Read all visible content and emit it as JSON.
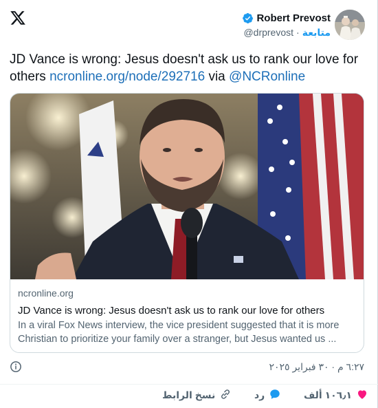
{
  "header": {
    "logo": "x-logo-icon",
    "author_name": "Robert Prevost",
    "handle": "@drprevost",
    "separator": "·",
    "follow_label": "متابعة",
    "verified_color": "#1d9bf0"
  },
  "tweet": {
    "text_line": "JD Vance is wrong: Jesus doesn't ask us to rank our love for others",
    "link": "ncronline.org/node/292716",
    "via": "via",
    "mention": "@NCRonline"
  },
  "card": {
    "domain": "ncronline.org",
    "title": "JD Vance is wrong: Jesus doesn't ask us to rank our love for others",
    "description": "In a viral Fox News interview, the vice president suggested that it is more Christian to prioritize your family over a stranger, but Jesus wanted us ..."
  },
  "meta": {
    "timestamp": "٦:٢٧ م · ٣٠ فبراير ٢٠٢٥",
    "info_icon": "info-icon"
  },
  "actions": {
    "like_count": "١٠٦٫١ ألف",
    "reply_label": "رد",
    "copy_link_label": "نسخ الرابط",
    "like_color": "#f91880",
    "reply_color": "#1d9bf0"
  }
}
